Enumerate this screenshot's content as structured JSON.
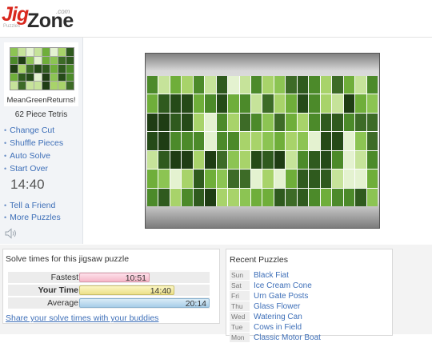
{
  "header": {
    "logo_jig": "Jig",
    "logo_zone": "Zone",
    "logo_com": ".com",
    "logo_tagline": "Puzzles"
  },
  "sidebar": {
    "puzzle_name": "MeanGreenReturns!",
    "piece_info": "62 Piece Tetris",
    "menu": [
      {
        "label": "Change Cut"
      },
      {
        "label": "Shuffle Pieces"
      },
      {
        "label": "Auto Solve"
      },
      {
        "label": "Start Over"
      }
    ],
    "timer": "14:40",
    "menu2": [
      {
        "label": "Tell a Friend"
      },
      {
        "label": "More Puzzles"
      }
    ],
    "sound_icon": "speaker-icon"
  },
  "solve_times": {
    "title": "Solve times for this jigsaw puzzle",
    "rows": [
      {
        "label": "Fastest",
        "value": "10:51",
        "fraction": 0.54,
        "bold": false,
        "style": "fast"
      },
      {
        "label": "Your Time",
        "value": "14:40",
        "fraction": 0.73,
        "bold": true,
        "style": "yours"
      },
      {
        "label": "Average",
        "value": "20:14",
        "fraction": 1.0,
        "bold": false,
        "style": "avg"
      }
    ],
    "share_link": "Share your solve times with your buddies"
  },
  "recent": {
    "title": "Recent Puzzles",
    "items": [
      {
        "day": "Sun",
        "name": "Black Fiat"
      },
      {
        "day": "Sat",
        "name": "Ice Cream Cone"
      },
      {
        "day": "Fri",
        "name": "Urn Gate Posts"
      },
      {
        "day": "Thu",
        "name": "Glass Flower"
      },
      {
        "day": "Wed",
        "name": "Watering Can"
      },
      {
        "day": "Tue",
        "name": "Cows in Field"
      },
      {
        "day": "Mon",
        "name": "Classic Motor Boat"
      }
    ]
  },
  "colors": {
    "link": "#3e6fb8",
    "logo_red": "#d9281e",
    "puzzle_palette": [
      "#2f5a1e",
      "#6fae3a",
      "#a8d36a",
      "#1f3d14",
      "#4c8a2a",
      "#c6e39a",
      "#3d6b27",
      "#8cc453",
      "#e4f2d0",
      "#254a18"
    ]
  }
}
